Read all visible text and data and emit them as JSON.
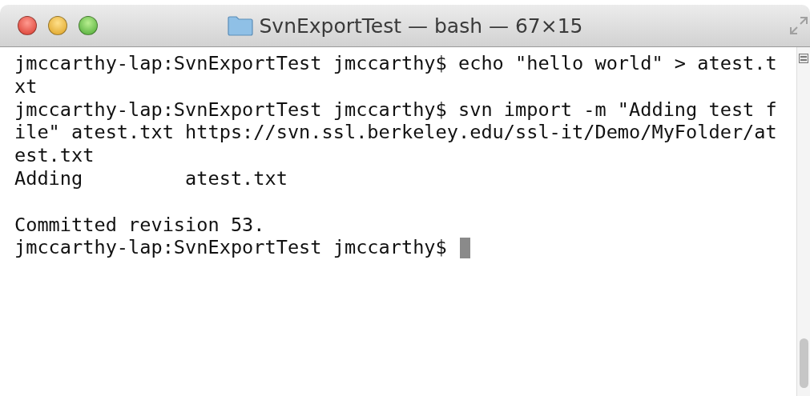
{
  "window": {
    "title": "SvnExportTest — bash — 67×15"
  },
  "terminal": {
    "lines": [
      {
        "kind": "text",
        "text": "jmccarthy-lap:SvnExportTest jmccarthy$ echo \"hello world\" > atest.t",
        "cursor": false
      },
      {
        "kind": "text",
        "text": "xt",
        "cursor": false
      },
      {
        "kind": "text",
        "text": "jmccarthy-lap:SvnExportTest jmccarthy$ svn import -m \"Adding test f",
        "cursor": false
      },
      {
        "kind": "text",
        "text": "ile\" atest.txt https://svn.ssl.berkeley.edu/ssl-it/Demo/MyFolder/at",
        "cursor": false
      },
      {
        "kind": "text",
        "text": "est.txt",
        "cursor": false
      },
      {
        "kind": "text",
        "text": "Adding         atest.txt",
        "cursor": false
      },
      {
        "kind": "blank"
      },
      {
        "kind": "text",
        "text": "Committed revision 53.",
        "cursor": false
      },
      {
        "kind": "text",
        "text": "jmccarthy-lap:SvnExportTest jmccarthy$",
        "cursor": true
      }
    ]
  }
}
